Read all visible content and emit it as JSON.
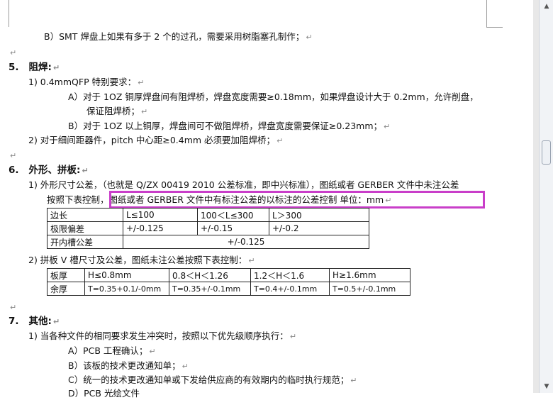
{
  "pilcrow": "↵",
  "lines": {
    "l_b_smt": "B）SMT 焊盘上如果有多于 2 个的过孔，需要采用树脂塞孔制作；",
    "h5_num": "5.",
    "h5_title": "阻焊:",
    "s5_1": "1)  0.4mmQFP 特别要求：",
    "s5_1a_1": "A）对于 1OZ 铜厚焊盘间有阻焊桥，焊盘宽度需要≥0.18mm，如果焊盘设计大于 0.2mm，允许削盘，",
    "s5_1a_2": "保证阻焊桥；",
    "s5_1b": "B）对于 1OZ 以上铜厚，焊盘间可不做阻焊桥，焊盘宽度需要保证≥0.23mm；",
    "s5_2": "2)  对于细间距器件，pitch 中心距≥0.4mm 必须要加阻焊桥；",
    "h6_num": "6.",
    "h6_title": "外形、拼板:",
    "s6_1_line1": "1)  外形尺寸公差，（也就是 Q/ZX 00419 2010 公差标准，即中兴标准），图纸或者 GERBER 文件中未注公差",
    "s6_1_line2a": "按照下表控制，",
    "s6_1_line2b": "图纸或者 GERBER 文件中有标注公差的以标注的公差控制   单位：mm",
    "s6_2": "2)  拼板 V 槽尺寸及公差，图纸未注公差按照下表控制：",
    "h7_num": "7.",
    "h7_title": "其他:",
    "s7_1": "1)  当各种文件的相同要求发生冲突时，按照以下优先级顺序执行：",
    "s7_1a": "A）PCB 工程确认；",
    "s7_1b": "B）该板的技术更改通知单；",
    "s7_1c": "C）统一的技术更改通知单或下发给供应商的有效期内的临时执行规范；",
    "s7_1d": "D）PCB 光绘文件"
  },
  "table1": {
    "r1": [
      "边长",
      "L≤100",
      "100＜L≤300",
      "L＞300"
    ],
    "r2": [
      "极限偏差",
      "+/-0.125",
      "+/-0.15",
      "+/-0.2"
    ],
    "r3": [
      "开内槽公差",
      "+/-0.125"
    ]
  },
  "table2": {
    "r1": [
      "板厚",
      "H≤0.8mm",
      "0.8＜H＜1.26",
      "1.2＜H＜1.6",
      "H≥1.6mm"
    ],
    "r2": [
      "余厚",
      "T=0.35+0.1/-0mm",
      "T=0.35+/-0.1mm",
      "T=0.4+/-0.1mm",
      "T=0.5+/-0.1mm"
    ]
  },
  "colors": {
    "highlight_border": "#c93ec9",
    "squiggle": "#6cb04a"
  },
  "scrollbar": {
    "up_icon": "▲",
    "down_icon": "▼"
  }
}
